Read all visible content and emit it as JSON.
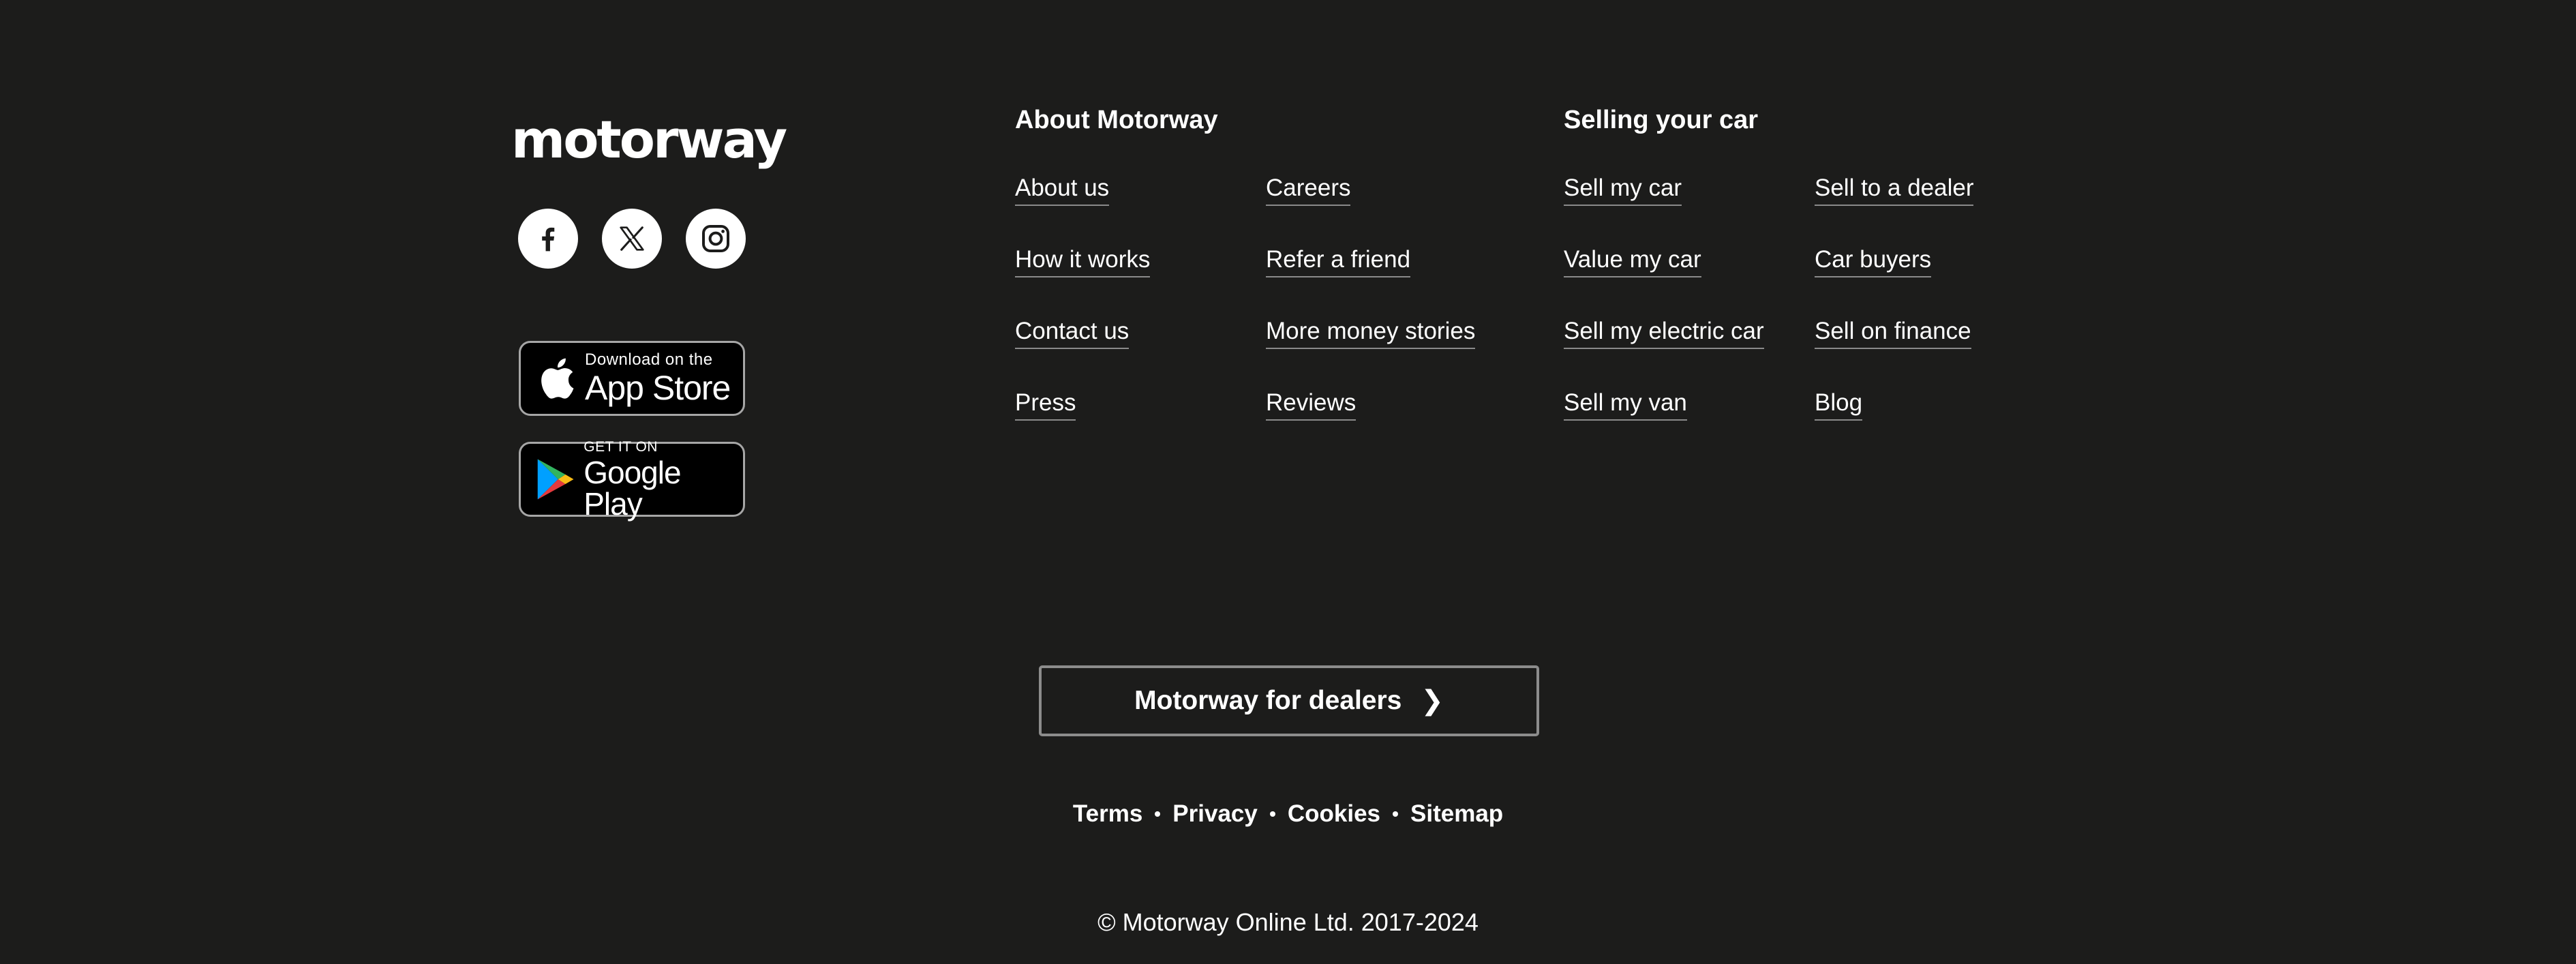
{
  "brand": {
    "logo_text": "motorway",
    "socials": [
      {
        "icon": "facebook-icon"
      },
      {
        "icon": "x-icon"
      },
      {
        "icon": "instagram-icon"
      }
    ],
    "app_store": {
      "small": "Download on the",
      "large": "App Store",
      "icon": "apple-icon"
    },
    "google_play": {
      "small": "GET IT ON",
      "large": "Google Play",
      "icon": "google-play-icon"
    }
  },
  "about": {
    "heading": "About Motorway",
    "links": [
      "About us",
      "How it works",
      "Contact us",
      "Press",
      "Careers",
      "Refer a friend",
      "More money stories",
      "Reviews"
    ]
  },
  "selling": {
    "heading": "Selling your car",
    "links": [
      "Sell my car",
      "Value my car",
      "Sell my electric car",
      "Sell my van",
      "Sell to a dealer",
      "Car buyers",
      "Sell on finance",
      "Blog"
    ]
  },
  "dealers_button": {
    "label": "Motorway for dealers",
    "icon": "chevron-right-icon"
  },
  "legal": {
    "links": [
      "Terms",
      "Privacy",
      "Cookies",
      "Sitemap"
    ]
  },
  "copyright": "© Motorway Online Ltd. 2017-2024",
  "colors": {
    "background": "#1c1c1b",
    "text": "#ffffff",
    "link_underline": "#8a8a8a",
    "button_border": "#8c8c8c"
  }
}
